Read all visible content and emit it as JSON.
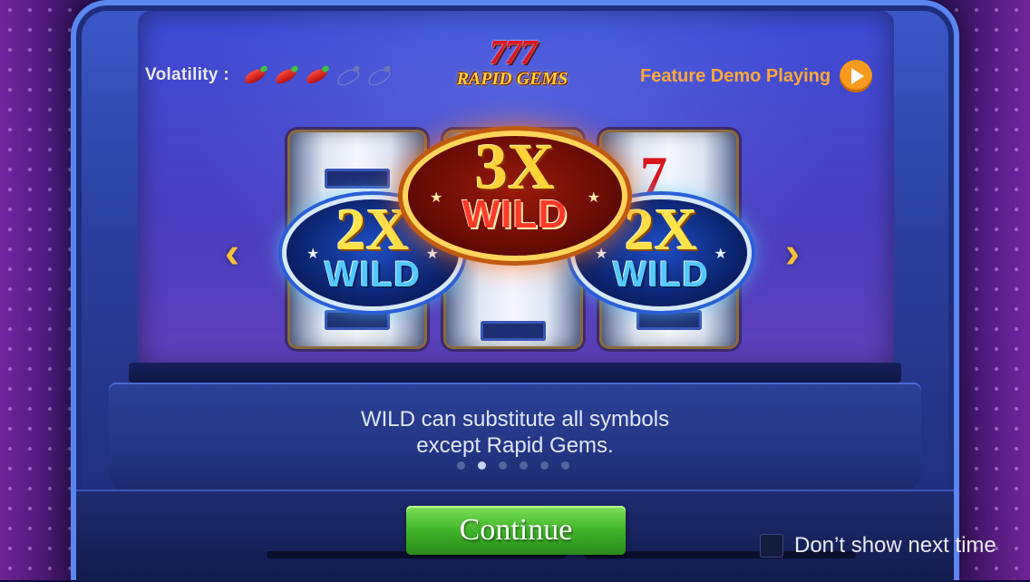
{
  "header": {
    "volatility_label": "Volatility :",
    "volatility": {
      "level": 3,
      "max": 5,
      "icon": "chili-pepper-icon"
    },
    "logo_top": "777",
    "logo_bottom": "RAPID GEMS",
    "feature_label": "Feature Demo Playing",
    "feature_icon": "play-icon"
  },
  "slide": {
    "badges": [
      {
        "multiplier": "2X",
        "word": "WILD",
        "color": "blue"
      },
      {
        "multiplier": "3X",
        "word": "WILD",
        "color": "red"
      },
      {
        "multiplier": "2X",
        "word": "WILD",
        "color": "blue"
      }
    ],
    "reel_symbol": "7",
    "description_line1": "WILD can substitute all symbols",
    "description_line2": "except Rapid Gems.",
    "page_count": 6,
    "current_page": 2,
    "prev_icon": "chevron-left-icon",
    "next_icon": "chevron-right-icon"
  },
  "footer": {
    "continue_label": "Continue",
    "dont_show_label": "Don’t show next time"
  },
  "colors": {
    "accent_orange": "#f79a1e",
    "gold": "#f4c238",
    "continue_green": "#3fb42a"
  }
}
